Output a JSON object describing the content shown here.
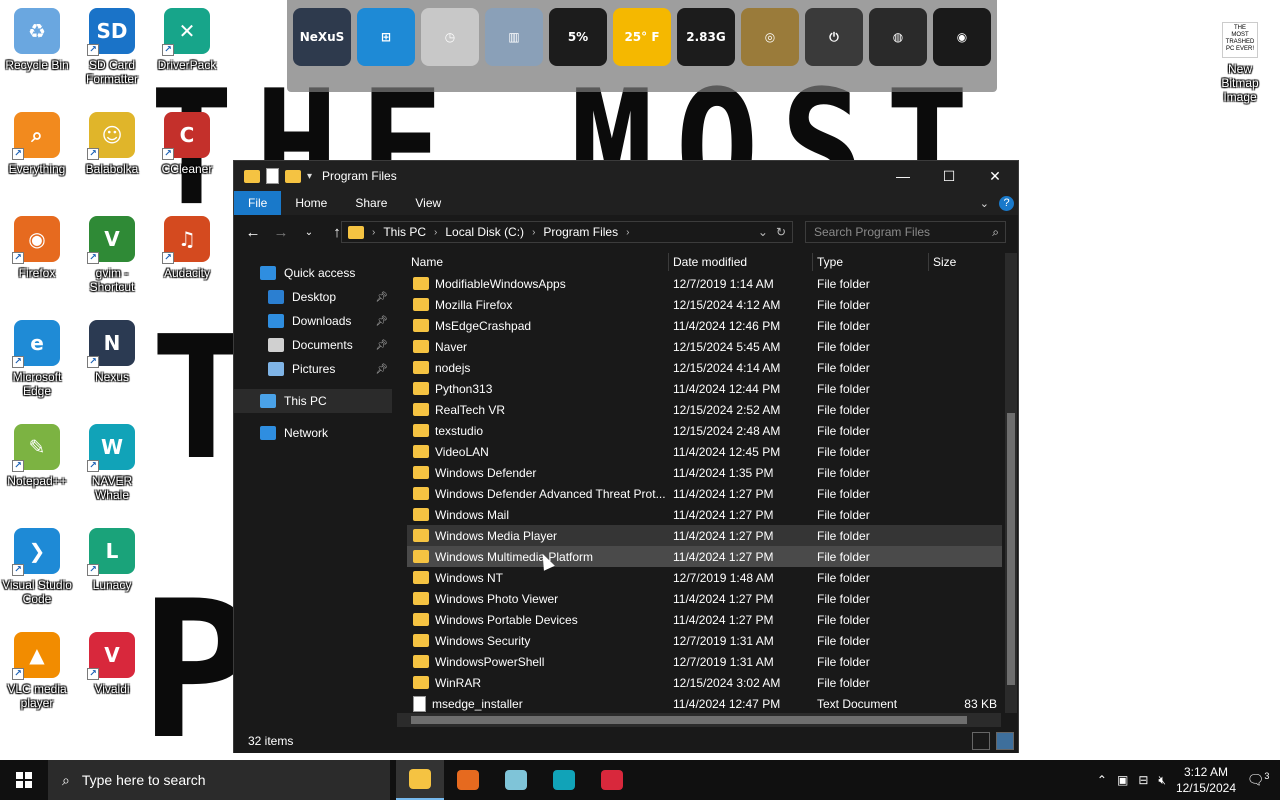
{
  "wallpaper": {
    "line1": "THE MOST",
    "line2": "T",
    "line3": "P"
  },
  "desktop_icons": [
    {
      "label": "Recycle Bin",
      "color": "#6aa7e0",
      "glyph": "♻"
    },
    {
      "label": "SD Card Formatter",
      "color": "#1a73c8",
      "glyph": "SD"
    },
    {
      "label": "DriverPack",
      "color": "#17a58a",
      "glyph": "✕"
    },
    {
      "label": "Everything",
      "color": "#f28a1e",
      "glyph": "⌕"
    },
    {
      "label": "Balabolka",
      "color": "#e0b52a",
      "glyph": "☺"
    },
    {
      "label": "CCleaner",
      "color": "#c4302b",
      "glyph": "C"
    },
    {
      "label": "Firefox",
      "color": "#e66a1f",
      "glyph": "◉"
    },
    {
      "label": "gvim - Shortcut",
      "color": "#2f8a36",
      "glyph": "V"
    },
    {
      "label": "Audacity",
      "color": "#d44a1f",
      "glyph": "♫"
    },
    {
      "label": "Microsoft Edge",
      "color": "#1f8bd6",
      "glyph": "e"
    },
    {
      "label": "Nexus",
      "color": "#2b3a52",
      "glyph": "N"
    },
    {
      "label": "Notepad++",
      "color": "#7cb342",
      "glyph": "✎"
    },
    {
      "label": "NAVER Whale",
      "color": "#11a3b8",
      "glyph": "W"
    },
    {
      "label": "Visual Studio Code",
      "color": "#1e8ad6",
      "glyph": "❯"
    },
    {
      "label": "Lunacy",
      "color": "#1aa37a",
      "glyph": "L"
    },
    {
      "label": "VLC media player",
      "color": "#f28c00",
      "glyph": "▲"
    },
    {
      "label": "Vivaldi",
      "color": "#d8283c",
      "glyph": "V"
    }
  ],
  "bitmap_icon": {
    "label": "New Bitmap Image",
    "thumb_text": "THE MOST TRASHED PC EVER!"
  },
  "dock": {
    "items": [
      {
        "name": "nexus",
        "text": "NeXuS",
        "color": "#2e3a4d"
      },
      {
        "name": "windows",
        "text": "⊞",
        "color": "#1e8ad6"
      },
      {
        "name": "clock",
        "text": "◷",
        "color": "#c8c8c8"
      },
      {
        "name": "recycle-bin",
        "text": "▥",
        "color": "#8aa0b8"
      },
      {
        "name": "cpu-meter",
        "text": "5%",
        "color": "#1c1c1c"
      },
      {
        "name": "weather",
        "text": "25° F",
        "color": "#f5b800"
      },
      {
        "name": "memory-meter",
        "text": "2.83G",
        "color": "#1c1c1c"
      },
      {
        "name": "network-globe",
        "text": "◎",
        "color": "#9a7b3a"
      },
      {
        "name": "power",
        "text": "⏻",
        "color": "#3a3a3a"
      },
      {
        "name": "speaker",
        "text": "◍",
        "color": "#2a2a2a"
      },
      {
        "name": "camera",
        "text": "◉",
        "color": "#1a1a1a"
      }
    ]
  },
  "window": {
    "title": "Program Files",
    "ribbon_tabs": [
      "File",
      "Home",
      "Share",
      "View"
    ],
    "address": [
      "This PC",
      "Local Disk (C:)",
      "Program Files"
    ],
    "search_placeholder": "Search Program Files",
    "nav": [
      {
        "label": "Quick access",
        "icon_color": "#2f8ee0",
        "level": 1,
        "pin": false
      },
      {
        "label": "Desktop",
        "icon_color": "#2b7fd1",
        "level": 2,
        "pin": true
      },
      {
        "label": "Downloads",
        "icon_color": "#2f8ee0",
        "level": 2,
        "pin": true
      },
      {
        "label": "Documents",
        "icon_color": "#d0d0d0",
        "level": 2,
        "pin": true
      },
      {
        "label": "Pictures",
        "icon_color": "#7fb4e6",
        "level": 2,
        "pin": true
      },
      {
        "label": "This PC",
        "icon_color": "#4aa2e8",
        "level": 1,
        "pin": false,
        "selected": true
      },
      {
        "label": "Network",
        "icon_color": "#2f8ee0",
        "level": 1,
        "pin": false
      }
    ],
    "columns": [
      "Name",
      "Date modified",
      "Type",
      "Size"
    ],
    "rows": [
      {
        "name": "ModifiableWindowsApps",
        "date": "12/7/2019 1:14 AM",
        "type": "File folder",
        "size": ""
      },
      {
        "name": "Mozilla Firefox",
        "date": "12/15/2024 4:12 AM",
        "type": "File folder",
        "size": ""
      },
      {
        "name": "MsEdgeCrashpad",
        "date": "11/4/2024 12:46 PM",
        "type": "File folder",
        "size": ""
      },
      {
        "name": "Naver",
        "date": "12/15/2024 5:45 AM",
        "type": "File folder",
        "size": ""
      },
      {
        "name": "nodejs",
        "date": "12/15/2024 4:14 AM",
        "type": "File folder",
        "size": ""
      },
      {
        "name": "Python313",
        "date": "11/4/2024 12:44 PM",
        "type": "File folder",
        "size": ""
      },
      {
        "name": "RealTech VR",
        "date": "12/15/2024 2:52 AM",
        "type": "File folder",
        "size": ""
      },
      {
        "name": "texstudio",
        "date": "12/15/2024 2:48 AM",
        "type": "File folder",
        "size": ""
      },
      {
        "name": "VideoLAN",
        "date": "11/4/2024 12:45 PM",
        "type": "File folder",
        "size": ""
      },
      {
        "name": "Windows Defender",
        "date": "11/4/2024 1:35 PM",
        "type": "File folder",
        "size": ""
      },
      {
        "name": "Windows Defender Advanced Threat Prot...",
        "date": "11/4/2024 1:27 PM",
        "type": "File folder",
        "size": ""
      },
      {
        "name": "Windows Mail",
        "date": "11/4/2024 1:27 PM",
        "type": "File folder",
        "size": ""
      },
      {
        "name": "Windows Media Player",
        "date": "11/4/2024 1:27 PM",
        "type": "File folder",
        "size": "",
        "state": "hl"
      },
      {
        "name": "Windows Multimedia Platform",
        "date": "11/4/2024 1:27 PM",
        "type": "File folder",
        "size": "",
        "state": "hl2"
      },
      {
        "name": "Windows NT",
        "date": "12/7/2019 1:48 AM",
        "type": "File folder",
        "size": ""
      },
      {
        "name": "Windows Photo Viewer",
        "date": "11/4/2024 1:27 PM",
        "type": "File folder",
        "size": ""
      },
      {
        "name": "Windows Portable Devices",
        "date": "11/4/2024 1:27 PM",
        "type": "File folder",
        "size": ""
      },
      {
        "name": "Windows Security",
        "date": "12/7/2019 1:31 AM",
        "type": "File folder",
        "size": ""
      },
      {
        "name": "WindowsPowerShell",
        "date": "12/7/2019 1:31 AM",
        "type": "File folder",
        "size": ""
      },
      {
        "name": "WinRAR",
        "date": "12/15/2024 3:02 AM",
        "type": "File folder",
        "size": ""
      },
      {
        "name": "msedge_installer",
        "date": "11/4/2024 12:47 PM",
        "type": "Text Document",
        "size": "83 KB",
        "kind": "file"
      }
    ],
    "status": {
      "item_count": "32 items"
    }
  },
  "taskbar": {
    "search_placeholder": "Type here to search",
    "apps": [
      {
        "name": "file-explorer",
        "color": "#f5c342",
        "active": true
      },
      {
        "name": "firefox",
        "color": "#e66a1f",
        "active": false
      },
      {
        "name": "sticky-app",
        "color": "#7fc4d8",
        "active": false
      },
      {
        "name": "naver-whale",
        "color": "#11a3b8",
        "active": false
      },
      {
        "name": "vivaldi",
        "color": "#d8283c",
        "active": false
      }
    ],
    "time": "3:12 AM",
    "date": "12/15/2024",
    "notifications": "3"
  }
}
